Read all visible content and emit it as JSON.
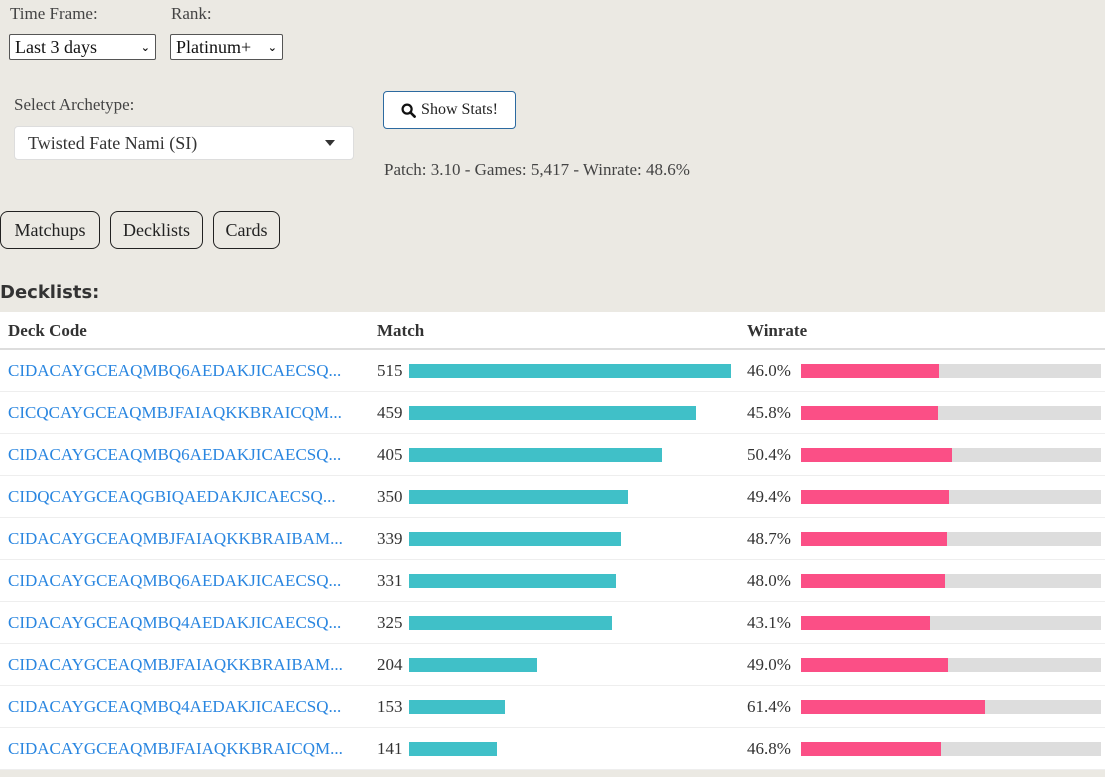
{
  "filters": {
    "time_frame_label": "Time Frame:",
    "time_frame_value": "Last 3 days",
    "rank_label": "Rank:",
    "rank_value": "Platinum+",
    "archetype_label": "Select Archetype:",
    "archetype_value": "Twisted Fate Nami (SI)"
  },
  "show_stats_label": "Show Stats!",
  "summary": "Patch: 3.10 - Games: 5,417 - Winrate: 48.6%",
  "tabs": [
    "Matchups",
    "Decklists",
    "Cards"
  ],
  "section_title": "Decklists:",
  "table": {
    "headers": [
      "Deck Code",
      "Match",
      "Winrate"
    ],
    "rows": [
      {
        "code": "CIDACAYGCEAQMBQ6AEDAKJICAECSQ...",
        "matches": 515,
        "matches_label": "515",
        "winrate": 46.0,
        "winrate_label": "46.0%"
      },
      {
        "code": "CICQCAYGCEAQMBJFAIAQKKBRAICQM...",
        "matches": 459,
        "matches_label": "459",
        "winrate": 45.8,
        "winrate_label": "45.8%"
      },
      {
        "code": "CIDACAYGCEAQMBQ6AEDAKJICAECSQ...",
        "matches": 405,
        "matches_label": "405",
        "winrate": 50.4,
        "winrate_label": "50.4%"
      },
      {
        "code": "CIDQCAYGCEAQGBIQAEDAKJICAECSQ...",
        "matches": 350,
        "matches_label": "350",
        "winrate": 49.4,
        "winrate_label": "49.4%"
      },
      {
        "code": "CIDACAYGCEAQMBJFAIAQKKBRAIBAM...",
        "matches": 339,
        "matches_label": "339",
        "winrate": 48.7,
        "winrate_label": "48.7%"
      },
      {
        "code": "CIDACAYGCEAQMBQ6AEDAKJICAECSQ...",
        "matches": 331,
        "matches_label": "331",
        "winrate": 48.0,
        "winrate_label": "48.0%"
      },
      {
        "code": "CIDACAYGCEAQMBQ4AEDAKJICAECSQ...",
        "matches": 325,
        "matches_label": "325",
        "winrate": 43.1,
        "winrate_label": "43.1%"
      },
      {
        "code": "CIDACAYGCEAQMBJFAIAQKKBRAIBAM...",
        "matches": 204,
        "matches_label": "204",
        "winrate": 49.0,
        "winrate_label": "49.0%"
      },
      {
        "code": "CIDACAYGCEAQMBQ4AEDAKJICAECSQ...",
        "matches": 153,
        "matches_label": "153",
        "winrate": 61.4,
        "winrate_label": "61.4%"
      },
      {
        "code": "CIDACAYGCEAQMBJFAIAQKKBRAICQM...",
        "matches": 141,
        "matches_label": "141",
        "winrate": 46.8,
        "winrate_label": "46.8%"
      }
    ]
  },
  "colors": {
    "match_bar": "#40c0c8",
    "winrate_bar": "#fb4f86",
    "link": "#2a86e0"
  }
}
